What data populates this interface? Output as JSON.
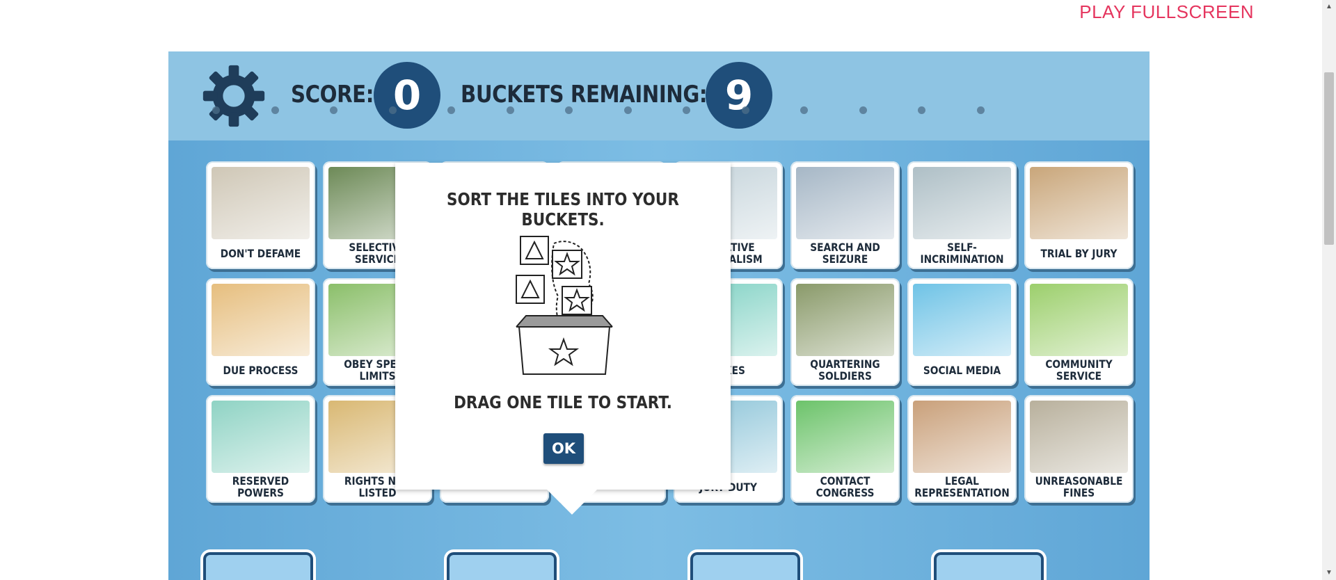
{
  "page": {
    "fullscreen_label": "PLAY FULLSCREEN"
  },
  "hud": {
    "score_label": "SCORE:",
    "score_value": "0",
    "buckets_label": "BUCKETS REMAINING:",
    "buckets_value": "9"
  },
  "tiles": [
    {
      "label": "DON'T DEFAME",
      "icon": "newspaper-image",
      "color": "#cfc7b6"
    },
    {
      "label": "SELECTIVE SERVICE",
      "icon": "soldiers-seal-image",
      "color": "#6d8a57"
    },
    {
      "label": "",
      "icon": "hidden-tile",
      "color": "#cccccc"
    },
    {
      "label": "",
      "icon": "hidden-tile",
      "color": "#cccccc"
    },
    {
      "label": "NEGATIVE FEDERALISM",
      "icon": "bulletin-board-image",
      "color": "#c4d3da"
    },
    {
      "label": "SEARCH AND SEIZURE",
      "icon": "police-search-image",
      "color": "#a6b7c6"
    },
    {
      "label": "SELF-INCRIMINATION",
      "icon": "interrogation-image",
      "color": "#aebfc6"
    },
    {
      "label": "TRIAL BY JURY",
      "icon": "jury-image",
      "color": "#c9a67a"
    },
    {
      "label": "DUE PROCESS",
      "icon": "family-house-image",
      "color": "#e6be7e"
    },
    {
      "label": "OBEY SPEED LIMITS",
      "icon": "speed-limit-car-image",
      "color": "#8bbf6a"
    },
    {
      "label": "",
      "icon": "hidden-tile",
      "color": "#cccccc"
    },
    {
      "label": "",
      "icon": "hidden-tile",
      "color": "#cccccc"
    },
    {
      "label": "TAXES",
      "icon": "paper-stack-image",
      "color": "#7fd1c3"
    },
    {
      "label": "QUARTERING SOLDIERS",
      "icon": "soldier-door-image",
      "color": "#8a9a6a"
    },
    {
      "label": "SOCIAL MEDIA",
      "icon": "social-network-image",
      "color": "#6fc3e6"
    },
    {
      "label": "COMMUNITY SERVICE",
      "icon": "park-cleanup-image",
      "color": "#9ccf6c"
    },
    {
      "label": "RESERVED POWERS",
      "icon": "texas-map-image",
      "color": "#8fd3c4"
    },
    {
      "label": "RIGHTS NOT LISTED",
      "icon": "scroll-image",
      "color": "#d9b873"
    },
    {
      "label": "",
      "icon": "hidden-tile",
      "color": "#cccccc"
    },
    {
      "label": "",
      "icon": "hidden-tile",
      "color": "#cccccc"
    },
    {
      "label": "JURY DUTY",
      "icon": "courtroom-image",
      "color": "#8cc4d8"
    },
    {
      "label": "CONTACT CONGRESS",
      "icon": "capitol-image",
      "color": "#6cc36a"
    },
    {
      "label": "LEGAL REPRESENTATION",
      "icon": "lawyer-handshake-image",
      "color": "#c9a07a"
    },
    {
      "label": "UNREASONABLE FINES",
      "icon": "jail-cell-image",
      "color": "#b8b09c"
    }
  ],
  "modal": {
    "title": "SORT THE TILES INTO YOUR BUCKETS.",
    "subtitle": "DRAG ONE TILE TO START.",
    "ok_label": "OK",
    "illustration_icon": "bucket-shapes-icon"
  },
  "colors": {
    "accent_link": "#e5355e",
    "hud_circle": "#1f4e7a",
    "header_bg": "#8ec4e3",
    "board_bg": "#6fb1dc",
    "ok_button": "#1f4e7a"
  }
}
